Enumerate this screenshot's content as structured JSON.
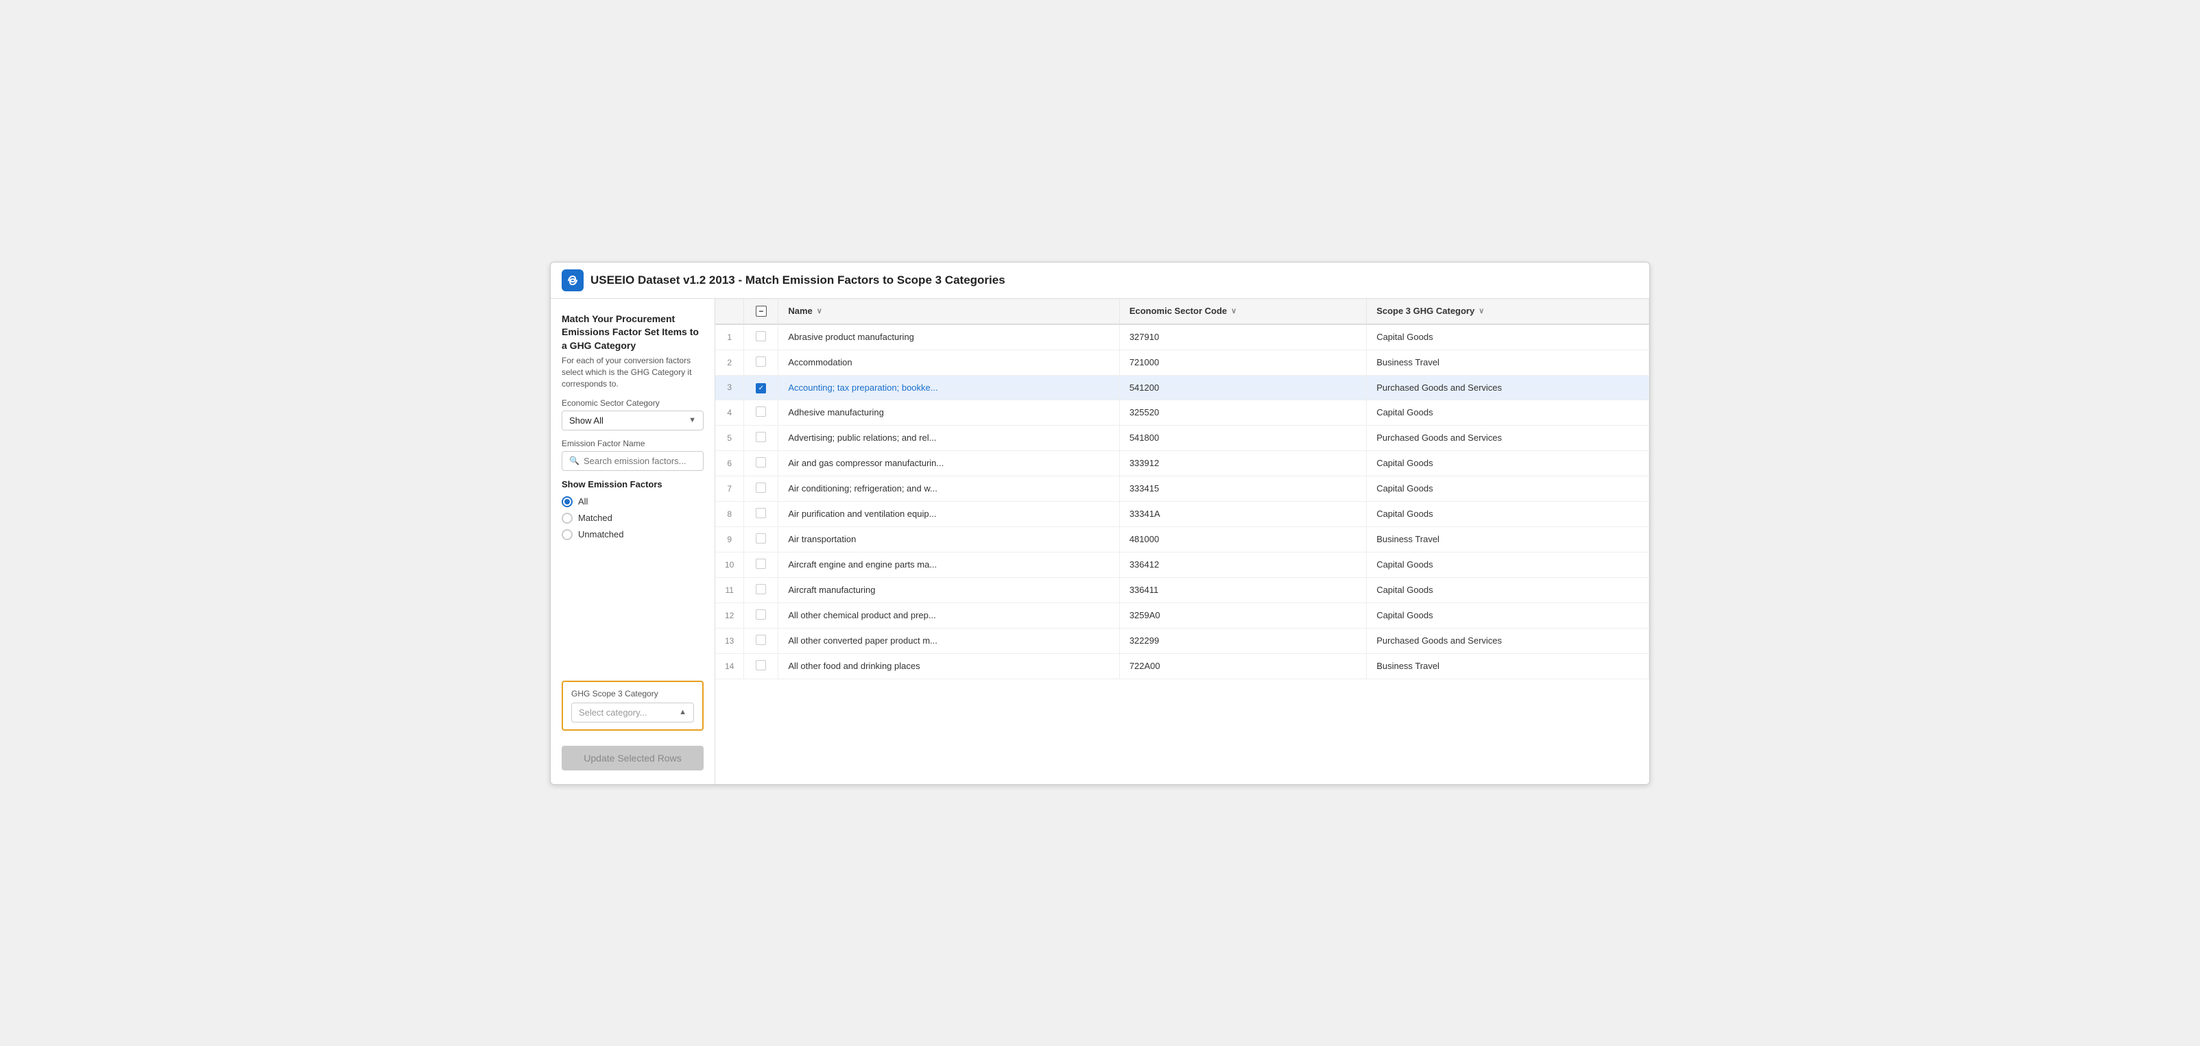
{
  "app": {
    "icon": "🔗",
    "title": "USEEIO Dataset v1.2 2013 - Match Emission Factors to Scope 3 Categories"
  },
  "sidebar": {
    "heading": "Match Your Procurement Emissions Factor Set Items to a GHG Category",
    "subtext": "For each of your conversion factors select which is the GHG Category it corresponds to.",
    "economic_sector_label": "Economic Sector Category",
    "economic_sector_value": "Show All",
    "emission_factor_label": "Emission Factor Name",
    "search_placeholder": "Search emission factors...",
    "show_factors_label": "Show Emission Factors",
    "radio_options": [
      {
        "id": "all",
        "label": "All",
        "selected": true
      },
      {
        "id": "matched",
        "label": "Matched",
        "selected": false
      },
      {
        "id": "unmatched",
        "label": "Unmatched",
        "selected": false
      }
    ],
    "ghg_label": "GHG Scope 3 Category",
    "ghg_placeholder": "Select category...",
    "update_button": "Update Selected Rows"
  },
  "table": {
    "columns": [
      {
        "id": "row-num",
        "label": ""
      },
      {
        "id": "checkbox",
        "label": ""
      },
      {
        "id": "name",
        "label": "Name"
      },
      {
        "id": "sector-code",
        "label": "Economic Sector Code"
      },
      {
        "id": "scope3",
        "label": "Scope 3 GHG Category"
      }
    ],
    "rows": [
      {
        "num": 1,
        "checked": false,
        "name": "Abrasive product manufacturing",
        "code": "327910",
        "scope3": "Capital Goods",
        "selected": false
      },
      {
        "num": 2,
        "checked": false,
        "name": "Accommodation",
        "code": "721000",
        "scope3": "Business Travel",
        "selected": false
      },
      {
        "num": 3,
        "checked": true,
        "name": "Accounting; tax preparation; bookke...",
        "code": "541200",
        "scope3": "Purchased Goods and Services",
        "selected": true,
        "is_link": true
      },
      {
        "num": 4,
        "checked": false,
        "name": "Adhesive manufacturing",
        "code": "325520",
        "scope3": "Capital Goods",
        "selected": false
      },
      {
        "num": 5,
        "checked": false,
        "name": "Advertising; public relations; and rel...",
        "code": "541800",
        "scope3": "Purchased Goods and Services",
        "selected": false
      },
      {
        "num": 6,
        "checked": false,
        "name": "Air and gas compressor manufacturin...",
        "code": "333912",
        "scope3": "Capital Goods",
        "selected": false
      },
      {
        "num": 7,
        "checked": false,
        "name": "Air conditioning; refrigeration; and w...",
        "code": "333415",
        "scope3": "Capital Goods",
        "selected": false
      },
      {
        "num": 8,
        "checked": false,
        "name": "Air purification and ventilation equip...",
        "code": "33341A",
        "scope3": "Capital Goods",
        "selected": false
      },
      {
        "num": 9,
        "checked": false,
        "name": "Air transportation",
        "code": "481000",
        "scope3": "Business Travel",
        "selected": false
      },
      {
        "num": 10,
        "checked": false,
        "name": "Aircraft engine and engine parts ma...",
        "code": "336412",
        "scope3": "Capital Goods",
        "selected": false
      },
      {
        "num": 11,
        "checked": false,
        "name": "Aircraft manufacturing",
        "code": "336411",
        "scope3": "Capital Goods",
        "selected": false
      },
      {
        "num": 12,
        "checked": false,
        "name": "All other chemical product and prep...",
        "code": "3259A0",
        "scope3": "Capital Goods",
        "selected": false
      },
      {
        "num": 13,
        "checked": false,
        "name": "All other converted paper product m...",
        "code": "322299",
        "scope3": "Purchased Goods and Services",
        "selected": false
      },
      {
        "num": 14,
        "checked": false,
        "name": "All other food and drinking places",
        "code": "722A00",
        "scope3": "Business Travel",
        "selected": false
      }
    ]
  }
}
